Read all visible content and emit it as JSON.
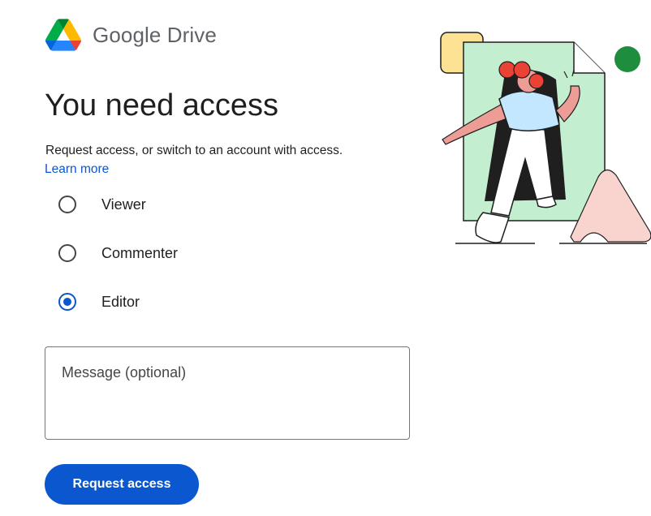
{
  "brand": {
    "name": "Google Drive",
    "logo_icon": "google-drive-logo-icon"
  },
  "page": {
    "title": "You need access",
    "subtitle": "Request access, or switch to an account with access.",
    "learn_more": "Learn more"
  },
  "roles": {
    "selected": "Editor",
    "options": [
      {
        "label": "Viewer",
        "checked": false
      },
      {
        "label": "Commenter",
        "checked": false
      },
      {
        "label": "Editor",
        "checked": true
      }
    ]
  },
  "message": {
    "placeholder": "Message (optional)",
    "value": ""
  },
  "actions": {
    "request_label": "Request access"
  },
  "illustration": {
    "icon": "person-entering-document-illustration"
  },
  "colors": {
    "accent": "#0b57d0",
    "text": "#1f1f1f",
    "muted": "#5f6368",
    "drive_green": "#1ea362",
    "drive_yellow": "#ffba00",
    "drive_blue": "#2684fc",
    "illus_green": "#c4eed0",
    "illus_yellow": "#fde293",
    "illus_pink": "#f9d4cf",
    "illus_dot": "#1e8e3e",
    "illus_red": "#ea4335"
  }
}
